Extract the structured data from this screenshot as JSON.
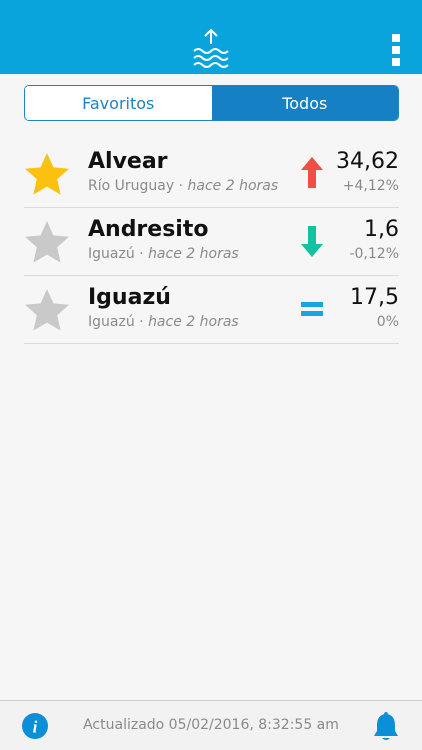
{
  "header": {
    "logo_icon": "water-level-up-icon",
    "menu_icon": "kebab-menu-icon",
    "color": "#0aa4dc"
  },
  "tabs": [
    {
      "label": "Favoritos",
      "selected": false
    },
    {
      "label": "Todos",
      "selected": true
    }
  ],
  "stations": [
    {
      "name": "Alvear",
      "river": "Río Uruguay",
      "separator": " · ",
      "time": "hace 2 horas",
      "level": "34,62",
      "change": "+4,12%",
      "favorite": true,
      "trend": "up",
      "trend_icon": "arrow-up-icon",
      "trend_color": "#f04e45"
    },
    {
      "name": "Andresito",
      "river": "Iguazú",
      "separator": " · ",
      "time": "hace 2 horas",
      "level": "1,6",
      "change": "-0,12%",
      "favorite": false,
      "trend": "down",
      "trend_icon": "arrow-down-icon",
      "trend_color": "#14c1a1"
    },
    {
      "name": "Iguazú",
      "river": "Iguazú",
      "separator": " · ",
      "time": "hace 2 horas",
      "level": "17,5",
      "change": "0%",
      "favorite": false,
      "trend": "equal",
      "trend_icon": "equals-icon",
      "trend_color": "#16a6e0"
    }
  ],
  "colors": {
    "star_favorite": "#fbc111",
    "star_default": "#c9c9c9",
    "accent": "#1581c4"
  },
  "footer": {
    "updated_text": "Actualizado 05/02/2016, 8:32:55 am",
    "info_icon": "info-icon",
    "bell_icon": "bell-icon"
  }
}
